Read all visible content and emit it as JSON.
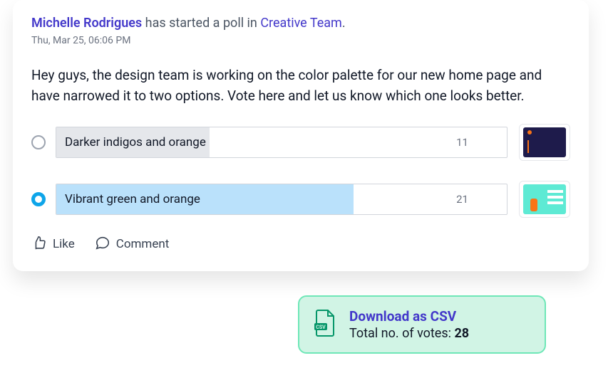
{
  "header": {
    "user_name": "Michelle Rodrigues",
    "mid_text": " has started a poll in ",
    "team_name": "Creative Team",
    "period": ".",
    "timestamp": "Thu, Mar 25, 06:06 PM"
  },
  "body": "Hey guys, the design team is working on the color palette for our new home page and have narrowed it to two options. Vote here and let us know which one looks better.",
  "poll": {
    "options": [
      {
        "label": "Darker indigos and orange",
        "count": "11",
        "fill_pct": 34,
        "selected": false
      },
      {
        "label": "Vibrant green and orange",
        "count": "21",
        "fill_pct": 66,
        "selected": true
      }
    ]
  },
  "actions": {
    "like": "Like",
    "comment": "Comment"
  },
  "download": {
    "link": "Download as CSV",
    "sub_prefix": "Total no. of votes: ",
    "total": "28"
  }
}
